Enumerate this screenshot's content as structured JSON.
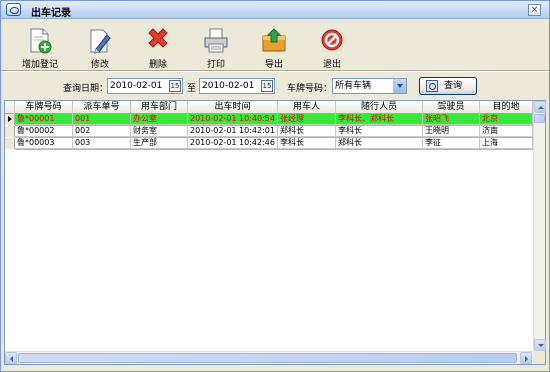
{
  "window": {
    "title": "出车记录",
    "close_label": "×"
  },
  "toolbar": {
    "items": [
      {
        "label": "增加登记",
        "icon": "add-register-icon"
      },
      {
        "label": "修改",
        "icon": "edit-icon"
      },
      {
        "label": "删除",
        "icon": "delete-icon"
      },
      {
        "label": "打印",
        "icon": "print-icon"
      },
      {
        "label": "导出",
        "icon": "export-icon"
      },
      {
        "label": "退出",
        "icon": "exit-icon"
      }
    ]
  },
  "query": {
    "date_label": "查询日期：",
    "start_date": "2010-02-01",
    "to_label": "至",
    "end_date": "2010-02-01",
    "plate_label": "车牌号码：",
    "plate_value": "所有车辆",
    "query_button": "查询",
    "calendar_glyph": "15"
  },
  "table": {
    "columns": [
      "车牌号码",
      "派车单号",
      "用车部门",
      "出车时间",
      "用车人",
      "随行人员",
      "驾驶员",
      "目的地"
    ],
    "rows": [
      [
        "鲁*00001",
        "001",
        "办公室",
        "2010-02-01 10:40:54",
        "张经理",
        "李科长、郑科长",
        "张昭飞",
        "北京"
      ],
      [
        "鲁*00002",
        "002",
        "财务室",
        "2010-02-01 10:42:01",
        "郑科长",
        "李科长",
        "王晓明",
        "济南"
      ],
      [
        "鲁*00003",
        "003",
        "生产部",
        "2010-02-01 10:42:46",
        "李科长",
        "郑科长",
        "李征",
        "上海"
      ]
    ],
    "selected_row": 0
  },
  "colors": {
    "selected_row_bg": "#35ea35",
    "selected_row_text": "#e00000",
    "row_separator": "#f2a65a"
  }
}
